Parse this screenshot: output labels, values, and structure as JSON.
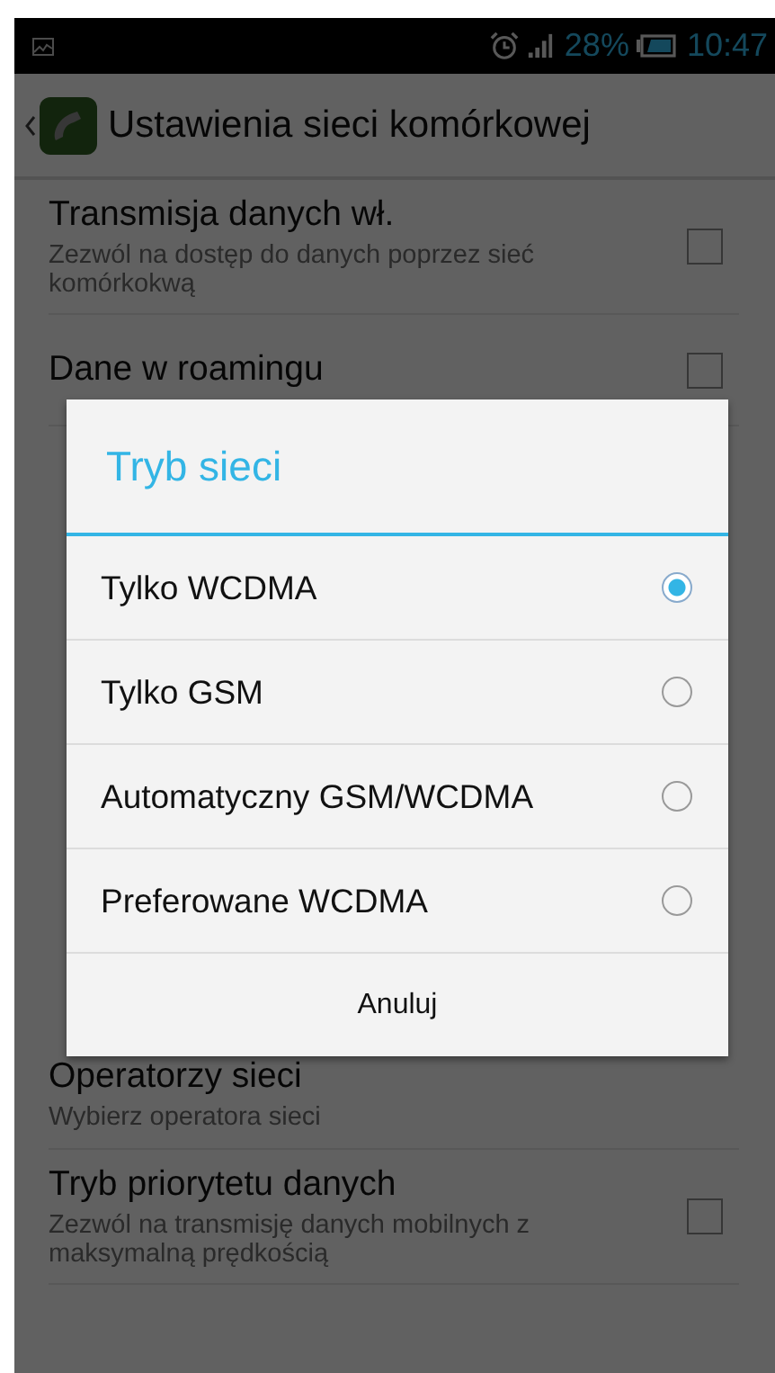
{
  "status_bar": {
    "battery_percent": "28%",
    "time": "10:47"
  },
  "action_bar": {
    "title": "Ustawienia sieci komórkowej"
  },
  "settings_top": [
    {
      "kind": "checkbox",
      "title": "Transmisja danych wł.",
      "summary": "Zezwól na dostęp do danych poprzez sieć komórkokwą",
      "checked": false
    },
    {
      "kind": "checkbox",
      "title": "Dane w roamingu",
      "checked": false
    }
  ],
  "settings_bottom": [
    {
      "kind": "link",
      "title": "Operatorzy sieci",
      "summary": "Wybierz operatora sieci"
    },
    {
      "kind": "checkbox",
      "title": "Tryb priorytetu danych",
      "summary": "Zezwól na transmisję danych mobilnych z maksymalną prędkością",
      "checked": false
    }
  ],
  "dialog": {
    "title": "Tryb sieci",
    "options": [
      {
        "label": "Tylko WCDMA",
        "selected": true
      },
      {
        "label": "Tylko GSM",
        "selected": false
      },
      {
        "label": "Automatyczny GSM/WCDMA",
        "selected": false
      },
      {
        "label": "Preferowane WCDMA",
        "selected": false
      }
    ],
    "cancel": "Anuluj"
  }
}
